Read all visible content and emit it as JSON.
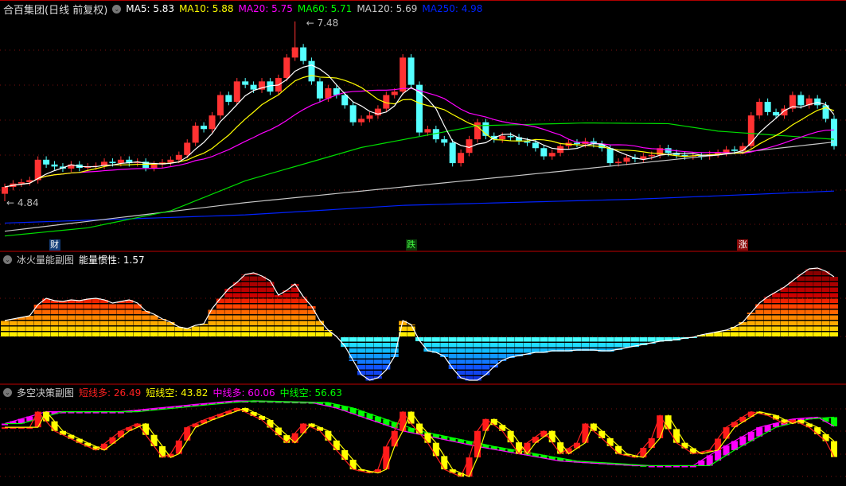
{
  "main_header": {
    "title": "合百集团(日线 前复权)",
    "ma": [
      {
        "label": "MA5: 5.83",
        "color": "#ffffff"
      },
      {
        "label": "MA10: 5.88",
        "color": "#ffff00"
      },
      {
        "label": "MA20: 5.75",
        "color": "#ff00ff"
      },
      {
        "label": "MA60: 5.71",
        "color": "#00ff00"
      },
      {
        "label": "MA120: 5.69",
        "color": "#c8c8c8"
      },
      {
        "label": "MA250: 4.98",
        "color": "#0022ff"
      }
    ]
  },
  "energy_header": {
    "title": "冰火量能副图",
    "value_label": "能量惯性: 1.57"
  },
  "decision_header": {
    "title": "多空决策副图",
    "items": [
      {
        "label": "短线多: 26.49",
        "color": "#ff2020"
      },
      {
        "label": "短线空: 43.82",
        "color": "#ffff00"
      },
      {
        "label": "中线多: 60.06",
        "color": "#ff00ff"
      },
      {
        "label": "中线空: 56.63",
        "color": "#00ff00"
      }
    ]
  },
  "markers": [
    {
      "text": "财",
      "index": 6,
      "bg": "#123c78",
      "fg": "#ffffff"
    },
    {
      "text": "跌",
      "index": 49,
      "bg": "#0a3a0a",
      "fg": "#44ff44"
    },
    {
      "text": "涨",
      "index": 89,
      "bg": "#8a0a0a",
      "fg": "#ffffff"
    }
  ],
  "annotations": {
    "high": "7.48",
    "low": "4.84"
  },
  "chart_data": [
    {
      "type": "candlestick",
      "title": "合百集团(日线 前复权)",
      "ylim": [
        4.29,
        7.7
      ],
      "first_open": 4.95,
      "high_point": {
        "index": 35,
        "value": 7.48
      },
      "low_point": {
        "index": 0,
        "value": 4.84
      },
      "close": [
        5.05,
        5.1,
        5.12,
        5.15,
        5.45,
        5.38,
        5.35,
        5.32,
        5.38,
        5.33,
        5.35,
        5.36,
        5.42,
        5.4,
        5.45,
        5.4,
        5.42,
        5.33,
        5.38,
        5.41,
        5.45,
        5.52,
        5.7,
        5.95,
        5.9,
        6.1,
        6.4,
        6.3,
        6.6,
        6.55,
        6.48,
        6.6,
        6.45,
        6.65,
        6.95,
        7.1,
        6.9,
        6.6,
        6.35,
        6.5,
        6.4,
        6.25,
        6.0,
        6.05,
        6.1,
        6.2,
        6.4,
        6.45,
        6.95,
        6.55,
        5.85,
        5.9,
        5.75,
        5.7,
        5.4,
        5.55,
        5.75,
        6.0,
        5.8,
        5.75,
        5.8,
        5.78,
        5.72,
        5.7,
        5.62,
        5.5,
        5.55,
        5.65,
        5.7,
        5.68,
        5.72,
        5.68,
        5.62,
        5.4,
        5.42,
        5.48,
        5.46,
        5.5,
        5.52,
        5.62,
        5.55,
        5.52,
        5.5,
        5.51,
        5.5,
        5.53,
        5.55,
        5.6,
        5.58,
        5.65,
        6.1,
        6.3,
        6.15,
        6.1,
        6.2,
        6.4,
        6.25,
        6.35,
        6.25,
        6.05,
        5.65
      ],
      "long_ma_anchors": {
        "MA60": [
          [
            0,
            4.33
          ],
          [
            10,
            4.45
          ],
          [
            20,
            4.7
          ],
          [
            29,
            5.14
          ],
          [
            43,
            5.63
          ],
          [
            57,
            5.95
          ],
          [
            70,
            5.99
          ],
          [
            80,
            5.98
          ],
          [
            86,
            5.87
          ],
          [
            100,
            5.75
          ]
        ],
        "MA120": [
          [
            0,
            4.4
          ],
          [
            29,
            4.82
          ],
          [
            48,
            5.05
          ],
          [
            67,
            5.28
          ],
          [
            86,
            5.52
          ],
          [
            100,
            5.71
          ]
        ],
        "MA250": [
          [
            0,
            4.52
          ],
          [
            29,
            4.64
          ],
          [
            48,
            4.78
          ],
          [
            76,
            4.87
          ],
          [
            100,
            4.99
          ]
        ]
      }
    },
    {
      "type": "bar",
      "title": "冰火量能副图",
      "ylim": [
        -55,
        86
      ],
      "values": [
        20,
        22,
        24,
        26,
        40,
        48,
        45,
        44,
        46,
        45,
        47,
        48,
        46,
        42,
        44,
        46,
        42,
        32,
        28,
        22,
        18,
        12,
        10,
        14,
        16,
        35,
        48,
        60,
        68,
        78,
        80,
        76,
        70,
        52,
        58,
        66,
        50,
        38,
        20,
        8,
        0,
        -12,
        -30,
        -48,
        -55,
        -52,
        -42,
        -25,
        20,
        15,
        -5,
        -18,
        -20,
        -25,
        -40,
        -52,
        -55,
        -55,
        -48,
        -38,
        -30,
        -26,
        -24,
        -22,
        -20,
        -20,
        -18,
        -18,
        -18,
        -17,
        -17,
        -17,
        -18,
        -18,
        -16,
        -14,
        -12,
        -10,
        -8,
        -6,
        -5,
        -4,
        -2,
        -1,
        2,
        4,
        6,
        8,
        12,
        18,
        30,
        42,
        50,
        56,
        62,
        70,
        78,
        85,
        86,
        82,
        75
      ]
    },
    {
      "type": "line",
      "title": "多空决策副图",
      "ylim": [
        0,
        100
      ],
      "short_anchors": [
        [
          0,
          59
        ],
        [
          3,
          59
        ],
        [
          4,
          76
        ],
        [
          6,
          55
        ],
        [
          9,
          42
        ],
        [
          11,
          34
        ],
        [
          14,
          55
        ],
        [
          16,
          63
        ],
        [
          19,
          26
        ],
        [
          20,
          30
        ],
        [
          22,
          59
        ],
        [
          24,
          67
        ],
        [
          28,
          80
        ],
        [
          31,
          67
        ],
        [
          34,
          42
        ],
        [
          36,
          63
        ],
        [
          38,
          55
        ],
        [
          40,
          34
        ],
        [
          42,
          13
        ],
        [
          44,
          9
        ],
        [
          45,
          13
        ],
        [
          46,
          38
        ],
        [
          47,
          55
        ],
        [
          48,
          76
        ],
        [
          49,
          63
        ],
        [
          51,
          42
        ],
        [
          53,
          13
        ],
        [
          55,
          5
        ],
        [
          56,
          26
        ],
        [
          57,
          55
        ],
        [
          58,
          68
        ],
        [
          60,
          55
        ],
        [
          62,
          30
        ],
        [
          63,
          42
        ],
        [
          65,
          55
        ],
        [
          67,
          30
        ],
        [
          69,
          42
        ],
        [
          70,
          63
        ],
        [
          72,
          47
        ],
        [
          74,
          30
        ],
        [
          76,
          26
        ],
        [
          78,
          47
        ],
        [
          79,
          72
        ],
        [
          81,
          42
        ],
        [
          83,
          30
        ],
        [
          85,
          34
        ],
        [
          87,
          59
        ],
        [
          90,
          76
        ],
        [
          92,
          72
        ],
        [
          94,
          63
        ],
        [
          95,
          67
        ],
        [
          97,
          59
        ],
        [
          99,
          43.82
        ],
        [
          100,
          26.49
        ]
      ],
      "mid_anchors": [
        [
          0,
          63
        ],
        [
          5,
          76
        ],
        [
          14,
          76
        ],
        [
          23,
          84
        ],
        [
          28,
          88
        ],
        [
          37,
          86
        ],
        [
          40,
          80
        ],
        [
          48,
          55
        ],
        [
          57,
          38
        ],
        [
          67,
          22
        ],
        [
          76,
          17
        ],
        [
          83,
          17
        ],
        [
          86,
          34
        ],
        [
          91,
          59
        ],
        [
          95,
          68
        ],
        [
          98,
          70
        ],
        [
          100,
          60.06
        ]
      ]
    }
  ]
}
